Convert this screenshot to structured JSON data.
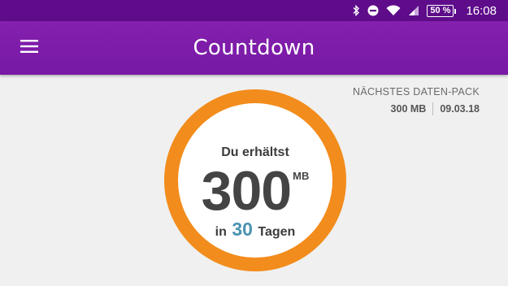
{
  "status_bar": {
    "icons": [
      "bluetooth-icon",
      "do-not-disturb-icon",
      "wifi-icon",
      "signal-icon"
    ],
    "battery": "50 %",
    "time": "16:08"
  },
  "app_bar": {
    "title": "Countdown",
    "menu_icon": "hamburger-menu-icon"
  },
  "next_pack": {
    "title": "NÄCHSTES DATEN-PACK",
    "amount": "300 MB",
    "date": "09.03.18"
  },
  "countdown": {
    "prefix": "Du erhältst",
    "value": "300",
    "unit": "MB",
    "in_label": "in",
    "days": "30",
    "days_label": "Tagen"
  },
  "colors": {
    "status_bar": "#5e0c8a",
    "app_bar": "#7b1fa2",
    "ring": "#f28c1c",
    "days_accent": "#4a93b0",
    "background": "#f0f0f0"
  }
}
